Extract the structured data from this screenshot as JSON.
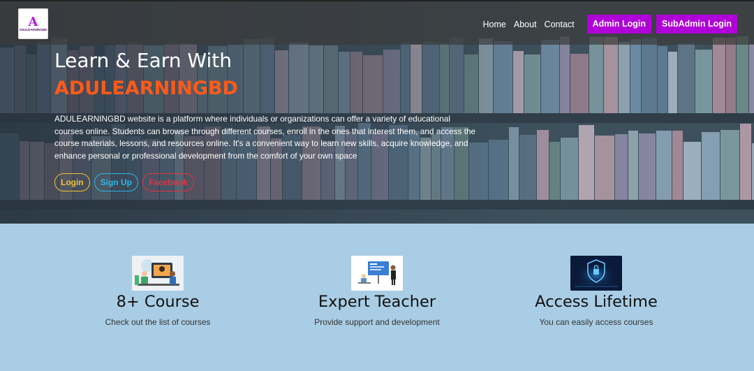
{
  "nav": {
    "logo_text": "ADULEARNINGBD",
    "links": [
      "Home",
      "About",
      "Contact"
    ],
    "buttons": [
      "Admin Login",
      "SubAdmin Login"
    ]
  },
  "hero": {
    "title": "Learn & Earn With",
    "brand": "ADULEARNINGBD",
    "description": "ADULEARNINGBD website is a platform where individuals or organizations can offer a variety of educational courses online. Students can browse through different courses, enroll in the ones that interest them, and access the course materials, lessons, and resources online. It's a convenient way to learn new skills, acquire knowledge, and enhance personal or professional development from the comfort of your own space",
    "actions": [
      "Login",
      "Sign Up",
      "Facebook"
    ]
  },
  "features": [
    {
      "title": "8+ Course",
      "subtitle": "Check out the list of courses",
      "icon": "online-class-illustration"
    },
    {
      "title": "Expert Teacher",
      "subtitle": "Provide support and development",
      "icon": "teacher-illustration"
    },
    {
      "title": "Access Lifetime",
      "subtitle": "You can easily access courses",
      "icon": "security-lock-illustration"
    }
  ],
  "colors": {
    "accent_purple": "#b000d8",
    "brand_orange": "#ff5a1a",
    "login_yellow": "#f2c230",
    "signup_blue": "#29b8e8",
    "facebook_red": "#e0353e",
    "features_bg": "#a9cde4"
  }
}
